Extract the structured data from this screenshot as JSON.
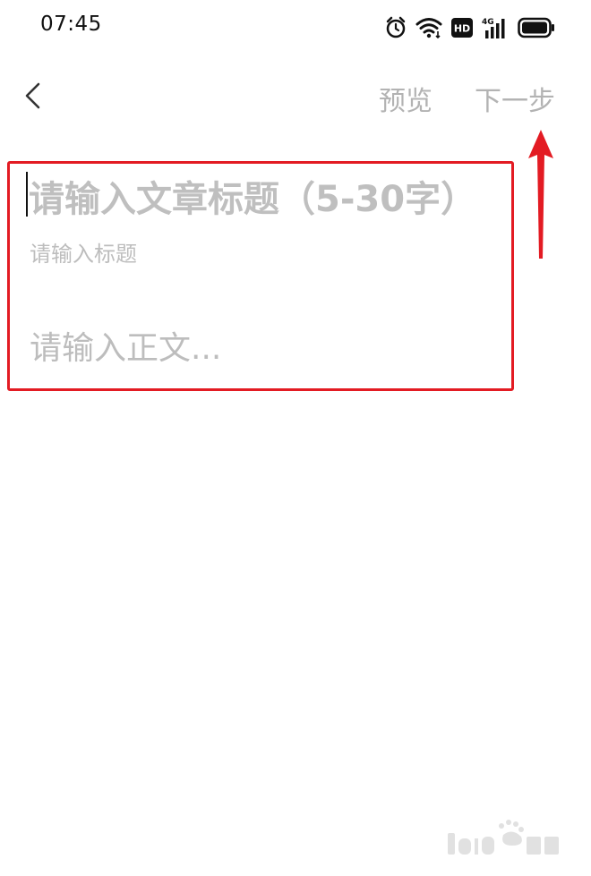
{
  "status_bar": {
    "time": "07:45",
    "icons": [
      "alarm-icon",
      "wifi-icon",
      "hd-icon",
      "signal-4g-icon",
      "battery-icon"
    ],
    "hd_label": "HD",
    "network_label": "4G"
  },
  "nav": {
    "back_icon": "chevron-left-icon",
    "preview_label": "预览",
    "next_label": "下一步"
  },
  "editor": {
    "title_placeholder": "请输入文章标题（5-30字）",
    "title_hint": "请输入标题",
    "body_placeholder": "请输入正文..."
  },
  "colors": {
    "annotation_red": "#e31b23",
    "placeholder_gray": "#bfbfbf",
    "nav_gray": "#b3b3b3"
  }
}
